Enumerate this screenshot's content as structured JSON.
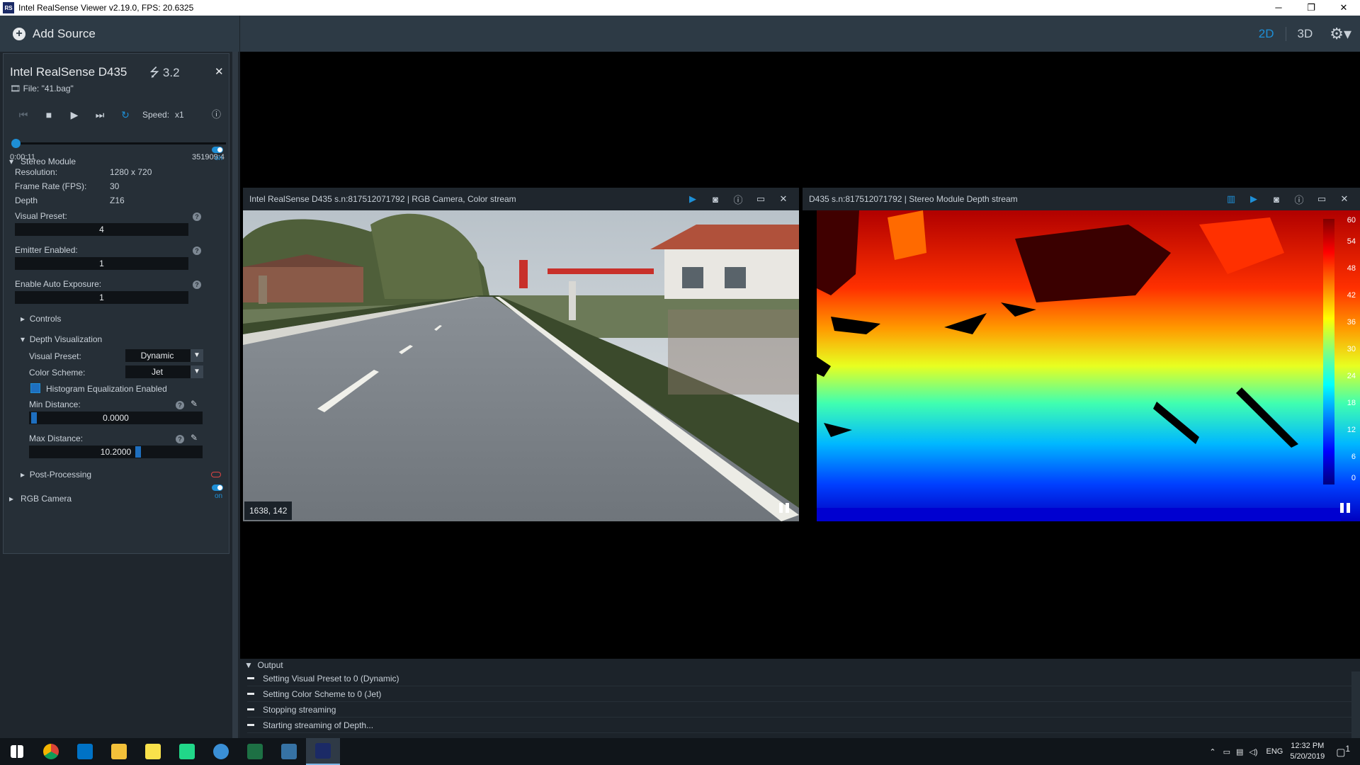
{
  "window": {
    "title": "Intel RealSense Viewer v2.19.0, FPS: 20.6325",
    "min": "─",
    "max": "❐",
    "close": "✕"
  },
  "toolbar": {
    "add_source": "Add Source",
    "view_2d": "2D",
    "view_3d": "3D"
  },
  "device": {
    "name": "Intel RealSense D435",
    "usb": "3.2",
    "file": "File: \"41.bag\"",
    "speed_label": "Speed:",
    "speed_value": "x1",
    "time_current": "0:00:11",
    "time_end": "351909:4",
    "seek_progress": 0.0
  },
  "stereo_module": {
    "title": "Stereo Module",
    "toggle": "on",
    "resolution_label": "Resolution:",
    "resolution_value": "1280 x 720",
    "fps_label": "Frame Rate (FPS):",
    "fps_value": "30",
    "depth_label": "Depth",
    "depth_value": "Z16",
    "visual_preset_label": "Visual Preset:",
    "visual_preset_value": "4",
    "emitter_label": "Emitter Enabled:",
    "emitter_value": "1",
    "auto_exposure_label": "Enable Auto Exposure:",
    "auto_exposure_value": "1",
    "controls": "Controls",
    "depth_vis": {
      "title": "Depth Visualization",
      "preset_label": "Visual Preset:",
      "preset_value": "Dynamic",
      "scheme_label": "Color Scheme:",
      "scheme_value": "Jet",
      "histogram_label": "Histogram Equalization Enabled",
      "min_label": "Min Distance:",
      "min_value": "0.0000",
      "max_label": "Max Distance:",
      "max_value": "10.2000"
    },
    "post_processing": "Post-Processing"
  },
  "rgb_camera": {
    "title": "RGB Camera",
    "toggle": "on"
  },
  "streams": {
    "color": {
      "title": "Intel RealSense D435 s.n:817512071792 | RGB Camera, Color stream",
      "coords": "1638, 142"
    },
    "depth": {
      "title": "D435 s.n:817512071792 | Stereo Module Depth stream",
      "scale": [
        "60",
        "54",
        "48",
        "42",
        "36",
        "30",
        "24",
        "18",
        "12",
        "6",
        "0"
      ]
    }
  },
  "output": {
    "title": "Output",
    "lines": [
      "Setting Visual Preset to 0 (Dynamic)",
      "Setting Color Scheme to 0 (Jet)",
      "Stopping streaming",
      "Starting streaming of Depth..."
    ]
  },
  "taskbar": {
    "lang": "ENG",
    "time": "12:32 PM",
    "date": "5/20/2019",
    "notif_count": "1"
  },
  "colors": {
    "accent": "#1e8fd6",
    "panel": "#262f37",
    "toolbar": "#2d3a45"
  }
}
